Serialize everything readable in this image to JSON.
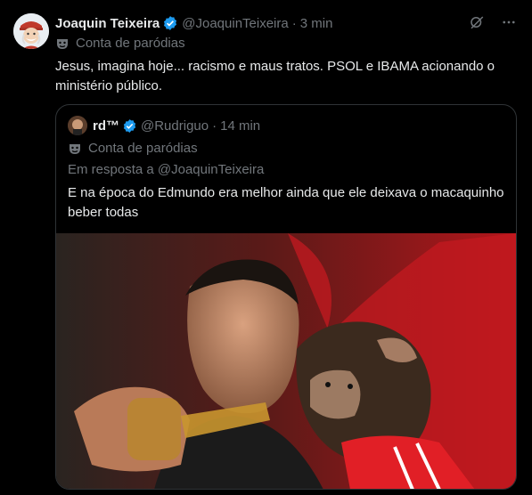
{
  "tweet": {
    "display_name": "Joaquin Teixeira",
    "handle": "@JoaquinTeixeira",
    "separator": "·",
    "time": "3 min",
    "parody_label": "Conta de paródias",
    "text": "Jesus, imagina hoje... racismo e maus tratos. PSOL e IBAMA acionando o ministério público."
  },
  "quoted": {
    "display_name": "rd™",
    "handle": "@Rudriguo",
    "separator": "·",
    "time": "14 min",
    "parody_label": "Conta de paródias",
    "reply_to": "Em resposta a @JoaquinTeixeira",
    "text": "E na época do Edmundo era melhor ainda que ele deixava o macaquinho beber todas"
  },
  "colors": {
    "background": "#000000",
    "text": "#e7e9ea",
    "secondary": "#71767b",
    "verified": "#1d9bf0",
    "border": "#2f3336"
  },
  "icons": [
    "verified-badge-icon",
    "grok-icon",
    "more-icon",
    "parody-mask-icon"
  ]
}
